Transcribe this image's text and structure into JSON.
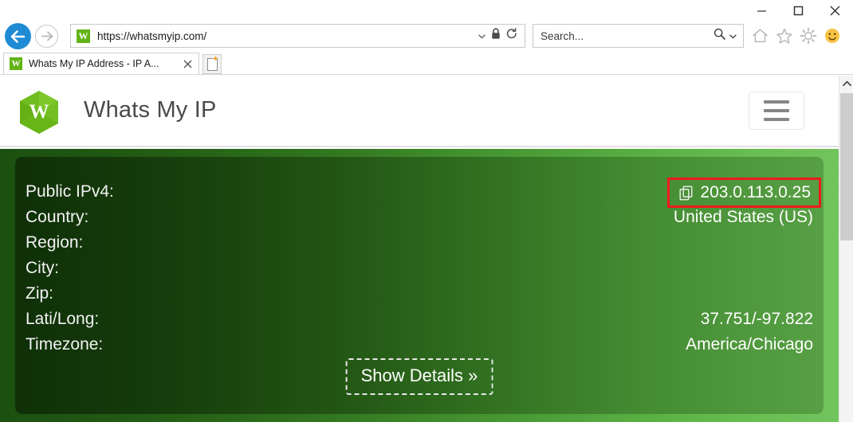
{
  "window": {
    "controls": [
      {
        "name": "minimize",
        "glyph": "minimize-icon"
      },
      {
        "name": "maximize",
        "glyph": "maximize-icon"
      },
      {
        "name": "close",
        "glyph": "close-icon"
      }
    ]
  },
  "browser": {
    "back_label": "Back",
    "forward_label": "Forward",
    "address": {
      "favicon_letter": "W",
      "url": "https://whatsmyip.com/",
      "icons": [
        "chevron-down-icon",
        "lock-icon",
        "refresh-icon"
      ]
    },
    "search": {
      "placeholder": "Search...",
      "value": "Search...",
      "icons": [
        "search-icon",
        "chevron-down-icon"
      ]
    },
    "toolbar_icons": [
      "home-icon",
      "favorites-star-icon",
      "settings-gear-icon",
      "smiley-icon"
    ],
    "tab": {
      "favicon_letter": "W",
      "title": "Whats My IP Address - IP A...",
      "close_label": "Close tab"
    },
    "new_tab_label": "New tab"
  },
  "site": {
    "logo_letter": "W",
    "title": "Whats My IP",
    "menu_label": "Menu"
  },
  "result": {
    "rows": [
      {
        "label": "Public IPv4:",
        "value": "203.0.113.0.25",
        "highlighted": true,
        "has_copy_icon": true
      },
      {
        "label": "Country:",
        "value": "United States (US)",
        "highlighted": false,
        "has_copy_icon": false
      },
      {
        "label": "Region:",
        "value": "",
        "highlighted": false,
        "has_copy_icon": false
      },
      {
        "label": "City:",
        "value": "",
        "highlighted": false,
        "has_copy_icon": false
      },
      {
        "label": "Zip:",
        "value": "",
        "highlighted": false,
        "has_copy_icon": false
      },
      {
        "label": "Lati/Long:",
        "value": "37.751/-97.822",
        "highlighted": false,
        "has_copy_icon": false
      },
      {
        "label": "Timezone:",
        "value": "America/Chicago",
        "highlighted": false,
        "has_copy_icon": false
      }
    ],
    "show_details_label": "Show Details »"
  },
  "colors": {
    "brand_green": "#63b317",
    "highlight_red": "#ee1b1b",
    "gradient_dark": "#1c5010",
    "gradient_light": "#72c45c",
    "back_button_blue": "#1e8bd4"
  }
}
